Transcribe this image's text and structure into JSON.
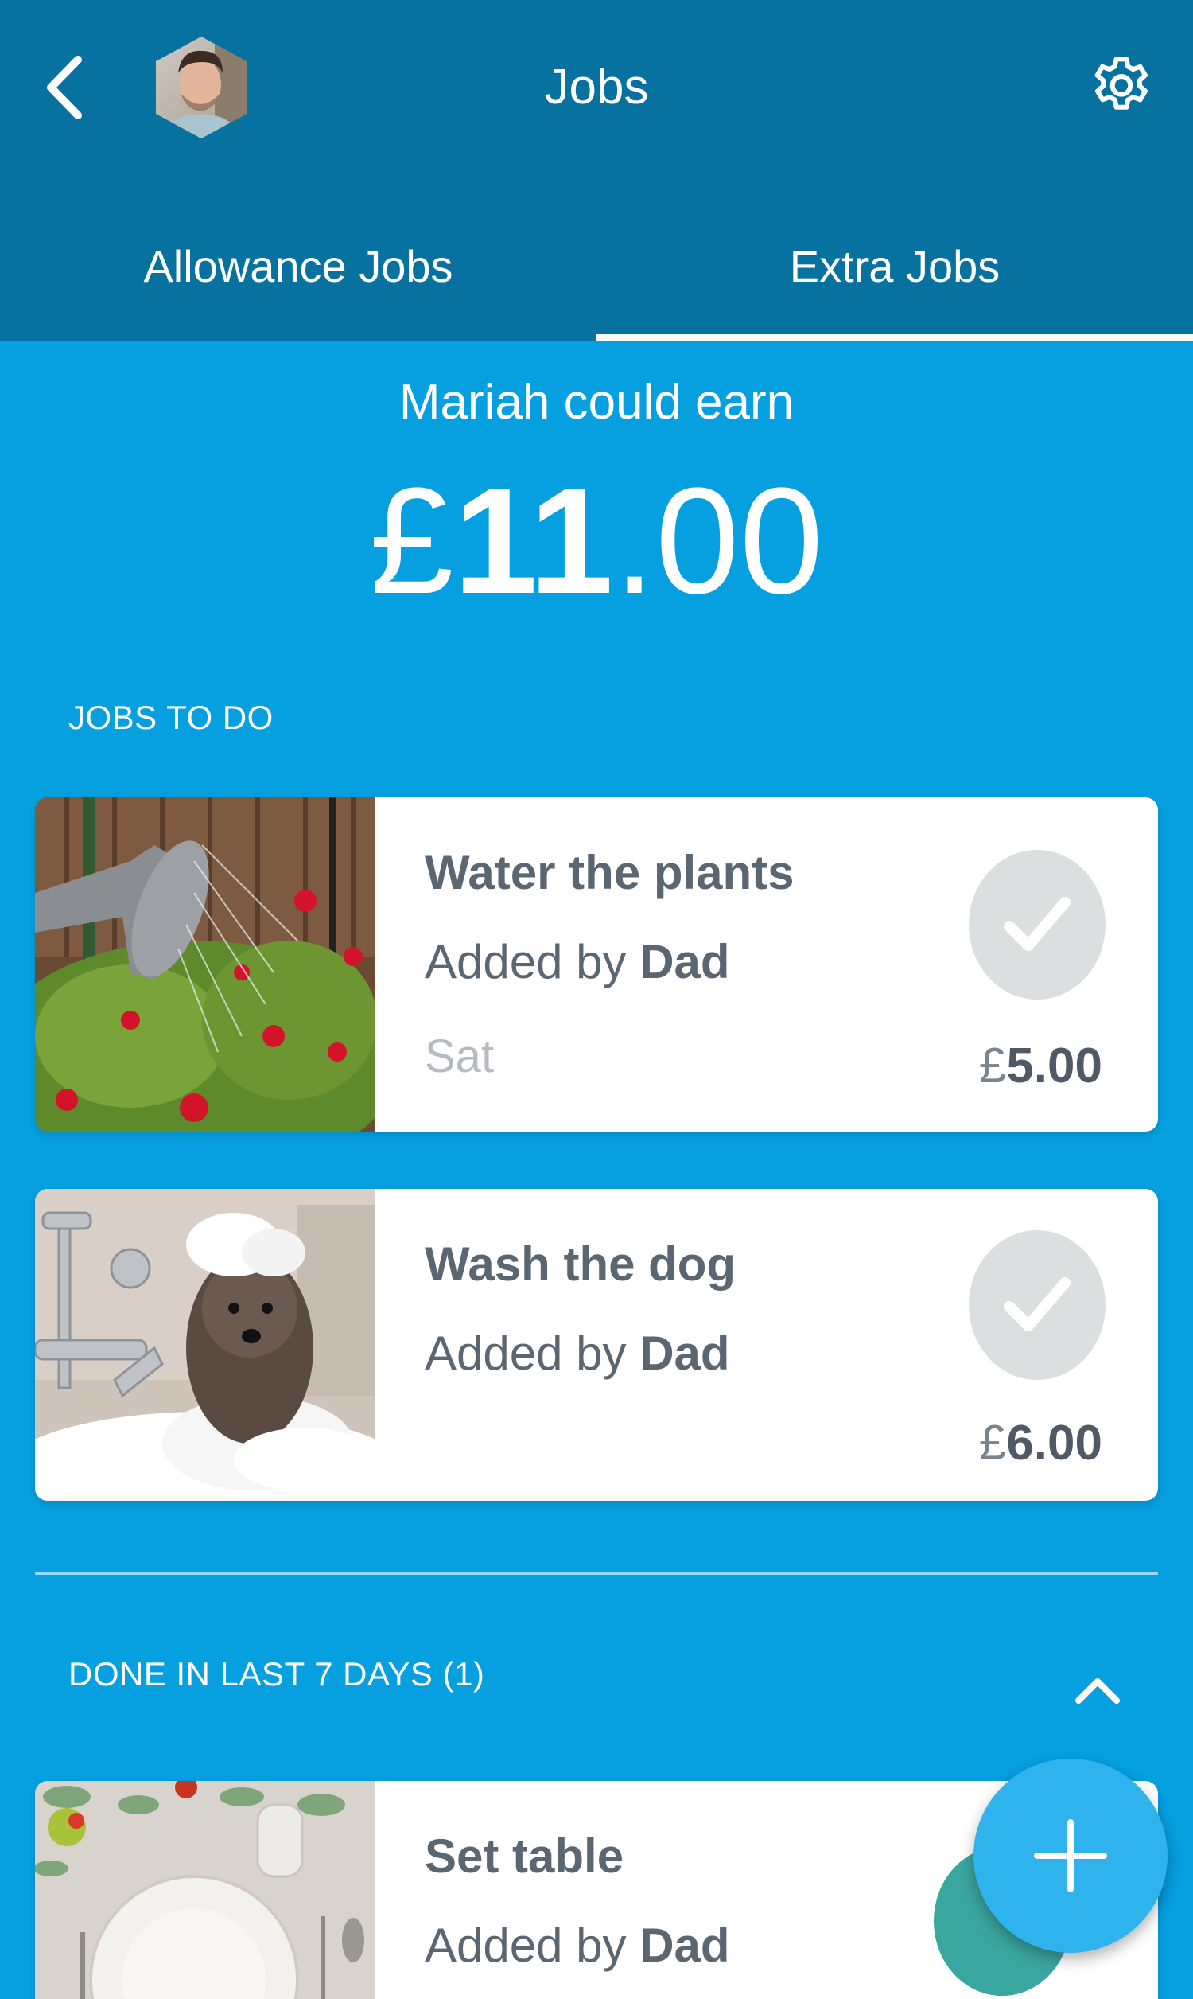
{
  "header": {
    "title": "Jobs",
    "back_icon": "chevron-left-icon",
    "settings_icon": "gear-icon",
    "avatar": "profile-photo"
  },
  "tabs": [
    {
      "label": "Allowance Jobs",
      "active": false
    },
    {
      "label": "Extra Jobs",
      "active": true
    }
  ],
  "earnings": {
    "label": "Mariah could earn",
    "currency": "£",
    "whole": "11",
    "decimal": ".00"
  },
  "sections": {
    "to_do": "JOBS TO DO",
    "done": "DONE IN LAST 7 DAYS (1)"
  },
  "jobs_to_do": [
    {
      "title": "Water the plants",
      "added_prefix": "Added by",
      "added_by": "Dad",
      "day": "Sat",
      "currency": "£",
      "price": "5.00",
      "image": "watering-can-photo"
    },
    {
      "title": "Wash the dog",
      "added_prefix": "Added by",
      "added_by": "Dad",
      "currency": "£",
      "price": "6.00",
      "image": "dog-bath-photo"
    }
  ],
  "jobs_done": [
    {
      "title": "Set table",
      "added_prefix": "Added by",
      "added_by": "Dad",
      "image": "table-setting-photo"
    }
  ],
  "colors": {
    "header": "#0772a0",
    "background": "#069fe0",
    "fab": "#2fb3ec",
    "check_circle": "#dcdedf",
    "done_check": "#3aa6a0"
  },
  "icons": {
    "check": "checkmark-icon",
    "collapse": "chevron-up-icon",
    "fab": "plus-icon"
  }
}
